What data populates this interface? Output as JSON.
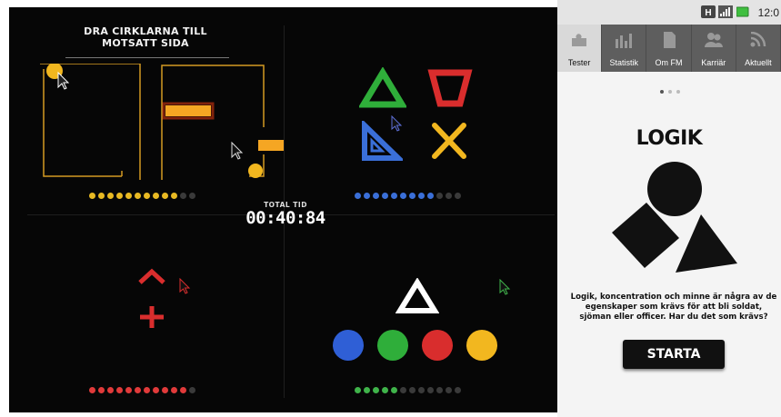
{
  "game": {
    "instruction_line1": "DRA CIRKLARNA TILL",
    "instruction_line2": "MOTSATT SIDA",
    "total_label": "TOTAL TID",
    "total_time": "00:40:84",
    "progress": {
      "maze": {
        "done": 10,
        "total": 12,
        "color": "#e8b923"
      },
      "shapes": {
        "done": 9,
        "total": 12,
        "color": "#3a6fd8"
      },
      "arrows": {
        "done": 11,
        "total": 12,
        "color": "#e03a3a"
      },
      "colors": {
        "done": 5,
        "total": 12,
        "color": "#3fb34a"
      }
    },
    "shape_icons": [
      "green-triangle-icon",
      "red-trapezoid-icon",
      "blue-set-square-icon",
      "yellow-cross-icon"
    ],
    "circle_colors": [
      "#2f5fd6",
      "#2fae3a",
      "#d92d2d",
      "#f2b71f"
    ]
  },
  "phone": {
    "status_time": "12:0",
    "tabs": [
      {
        "label": "Tester",
        "icon": "puzzle-icon"
      },
      {
        "label": "Statistik",
        "icon": "bar-chart-icon"
      },
      {
        "label": "Om FM",
        "icon": "document-icon"
      },
      {
        "label": "Karriär",
        "icon": "people-icon"
      },
      {
        "label": "Aktuellt",
        "icon": "rss-icon"
      }
    ],
    "title": "LOGIK",
    "description": "Logik, koncentration och minne är några av de egenskaper som krävs för att bli soldat, sjöman eller officer. Har du det som krävs?",
    "start_button": "STARTA"
  }
}
